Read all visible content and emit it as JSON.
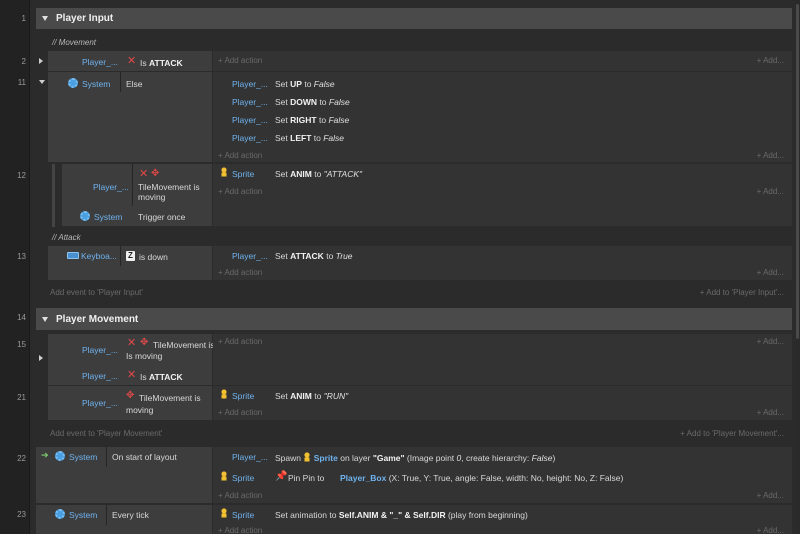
{
  "line_numbers": [
    "1",
    "2",
    "11",
    "12",
    "13",
    "14",
    "15",
    "21",
    "22",
    "23"
  ],
  "groups": {
    "player_input": "Player Input",
    "player_movement": "Player Movement"
  },
  "comments": {
    "movement": "// Movement",
    "attack": "// Attack"
  },
  "objects": {
    "player": "Player_...",
    "system": "System",
    "keyboard": "Keyboa...",
    "sprite": "Sprite"
  },
  "conditions": {
    "is_attack_prefix": "Is",
    "is_attack_name": "ATTACK",
    "else": "Else",
    "tile_movement_is_moving_1": "TileMovement is",
    "tile_movement_is_moving_2": "moving",
    "trigger_once": "Trigger once",
    "is_down": "is down",
    "z_key": "Z",
    "on_start_of_layout": "On start of layout",
    "every_tick": "Every tick"
  },
  "actions": {
    "set": "Set",
    "to": "to",
    "up": "UP",
    "down": "DOWN",
    "right": "RIGHT",
    "left": "LEFT",
    "false": "False",
    "true": "True",
    "anim": "ANIM",
    "attack_var": "ATTACK",
    "attack_value": "\"ATTACK\"",
    "run_value": "\"RUN\"",
    "spawn": "Spawn",
    "on_layer": "on layer",
    "game_layer": "\"Game\"",
    "spawn_tail_1": "(Image point ",
    "spawn_tail_zero": "0",
    "spawn_tail_2": ", create hierarchy: ",
    "spawn_tail_false": "False",
    "spawn_tail_3": ")",
    "pin_pin_to": "Pin Pin to",
    "player_box": "Player_Box",
    "pin_tail": "(X: True, Y: True, angle: False, width: No, height: No, Z: False)",
    "set_animation_to": "Set animation to",
    "set_animation_expr": "Self.ANIM & \"_\" & Self.DIR",
    "set_animation_tail": "(play from beginning)"
  },
  "links": {
    "add_action": "+ Add action",
    "add_short": "+ Add...",
    "add_event_player_input": "Add event to 'Player Input'",
    "add_to_player_input": "+ Add to 'Player Input'...",
    "add_event_player_movement": "Add event to 'Player Movement'",
    "add_to_player_movement": "+ Add to 'Player Movement'..."
  },
  "colors": {
    "object_link": "#6fb3ef",
    "condition_bg": "#3d3d3d",
    "action_bg": "#333333",
    "group_header_bg": "#4a4a4a",
    "icon_red": "#e04848"
  }
}
